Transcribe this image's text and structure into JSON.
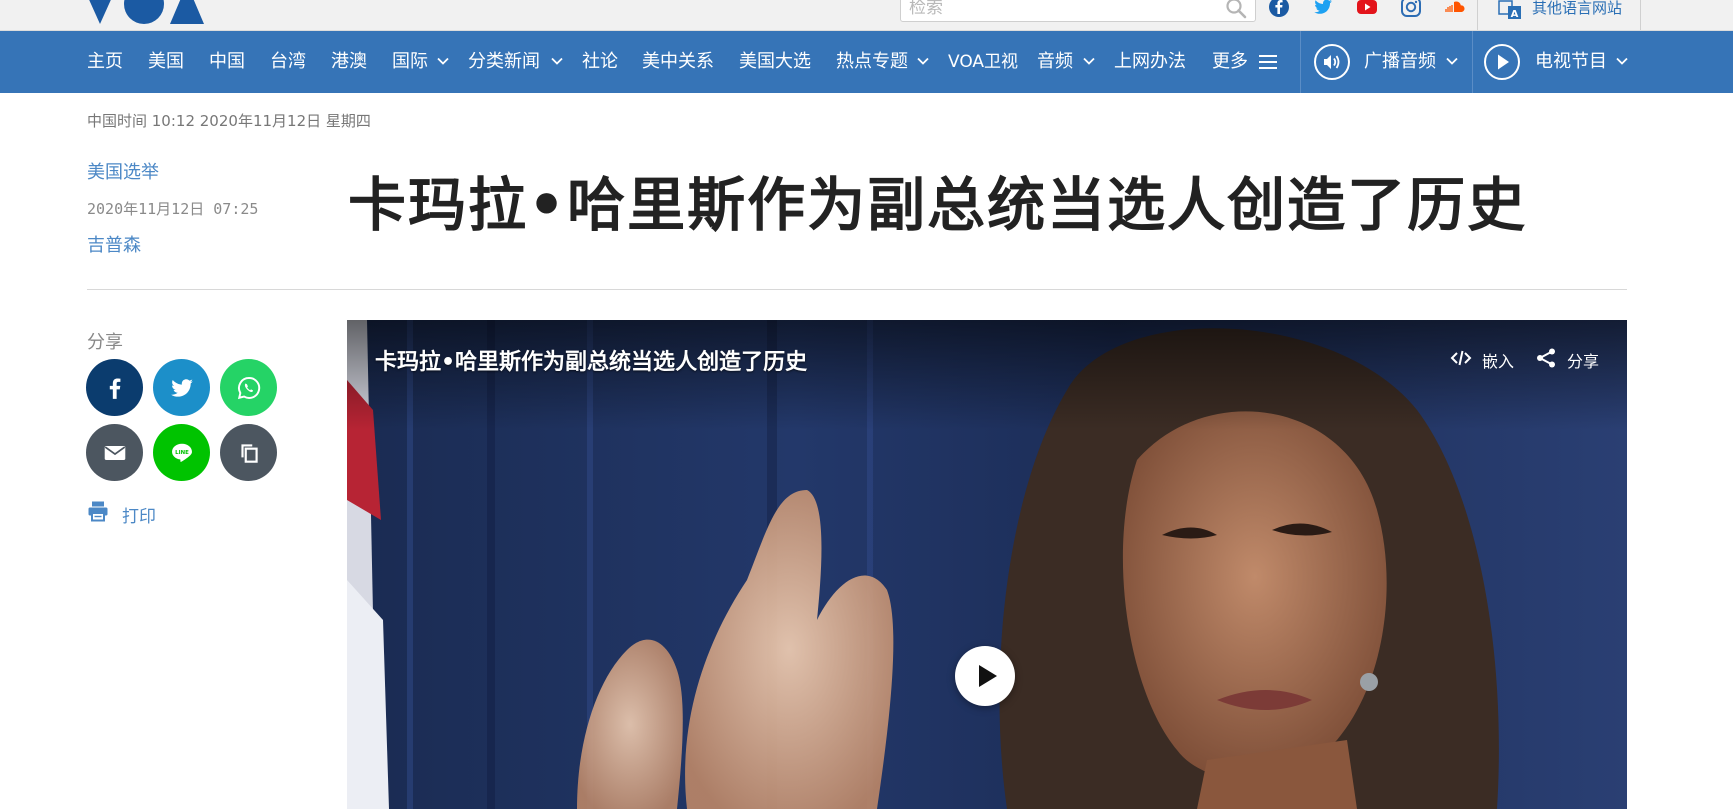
{
  "topbar": {
    "search_placeholder": "检索",
    "other_sites_label": "其他语言网站",
    "social_icons": [
      "facebook-icon",
      "twitter-icon",
      "youtube-icon",
      "instagram-icon",
      "soundcloud-icon"
    ]
  },
  "nav": {
    "items": [
      {
        "label": "主页"
      },
      {
        "label": "美国"
      },
      {
        "label": "中国"
      },
      {
        "label": "台湾"
      },
      {
        "label": "港澳"
      },
      {
        "label": "国际"
      },
      {
        "label": "分类新闻"
      },
      {
        "label": "社论"
      },
      {
        "label": "美中关系"
      },
      {
        "label": "美国大选"
      },
      {
        "label": "热点专题"
      },
      {
        "label": "VOA卫视"
      },
      {
        "label": "音频"
      },
      {
        "label": "上网办法"
      },
      {
        "label": "更多"
      }
    ],
    "radio_label": "广播音频",
    "tv_label": "电视节目"
  },
  "dateline": "中国时间 10:12 2020年11月12日 星期四",
  "article": {
    "category": "美国选举",
    "date": "2020年11月12日 07:25",
    "author": "吉普森",
    "headline": "卡玛拉•哈里斯作为副总统当选人创造了历史"
  },
  "share": {
    "label": "分享",
    "print_label": "打印",
    "colors": {
      "facebook": "#0b3c6e",
      "twitter": "#1c8fc9",
      "whatsapp": "#25d366",
      "email": "#4c5660",
      "line": "#00c300",
      "copy": "#4c5660"
    }
  },
  "video": {
    "title": "卡玛拉•哈里斯作为副总统当选人创造了历史",
    "embed_label": "嵌入",
    "share_label": "分享"
  },
  "colors": {
    "nav_bg": "#3674b7",
    "link": "#4c88c6"
  }
}
